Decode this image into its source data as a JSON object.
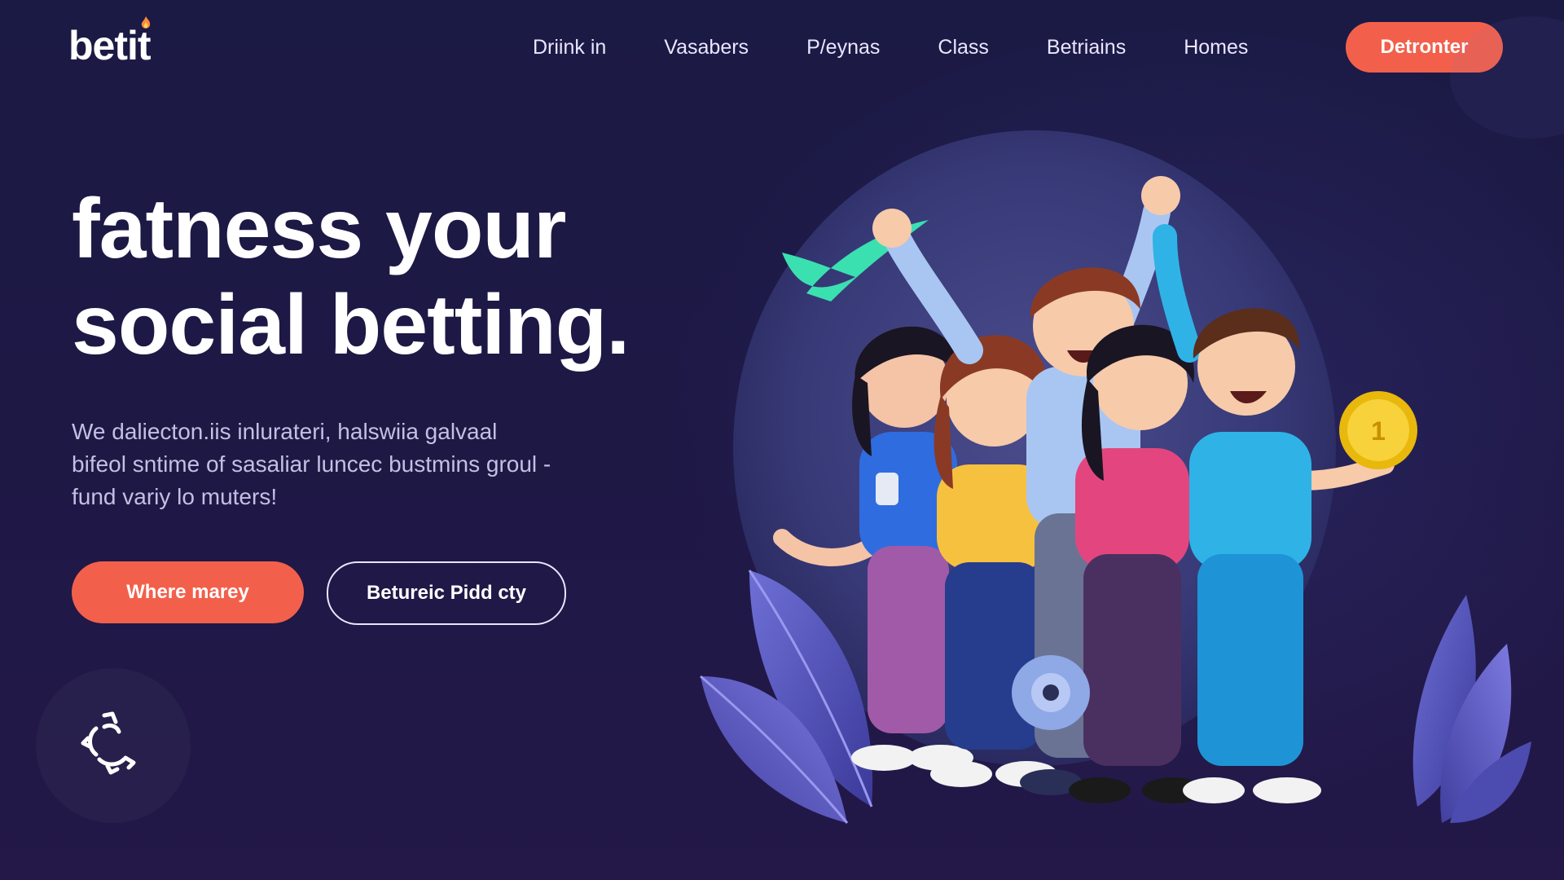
{
  "brand": {
    "logo_text": "betit"
  },
  "nav": {
    "items": [
      {
        "label": "Driink in"
      },
      {
        "label": "Vasabers"
      },
      {
        "label": "P/eynas"
      },
      {
        "label": "Class"
      },
      {
        "label": "Betriains"
      },
      {
        "label": "Homes"
      }
    ],
    "cta_label": "Detronter"
  },
  "hero": {
    "title_line1": "fatness your",
    "title_line2": "social betting.",
    "body_line1": "We daliecton.iis inlurateri, halswiia galvaal",
    "body_line2": "bifeol sntime of sasaliar luncec bustmins groul -",
    "body_line3": "fund variy lo muters!",
    "primary_button": "Where marey",
    "secondary_button": "Betureic Pidd cty"
  },
  "illustration": {
    "coin_label": "1"
  },
  "colors": {
    "accent": "#f2604c",
    "background": "#1d1844",
    "text_muted": "#c4bfe3"
  },
  "icons": {
    "loader": "loader-icon",
    "flame": "flame-icon",
    "checkmark": "checkmark-icon",
    "coin": "coin-icon"
  }
}
